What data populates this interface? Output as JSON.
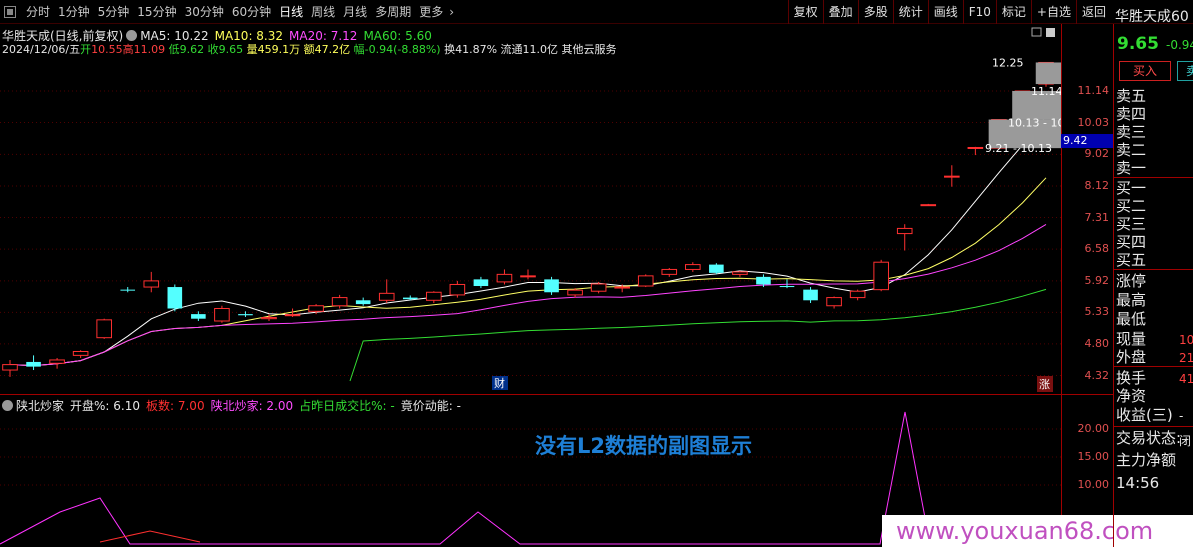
{
  "toolbar": {
    "timeframes": [
      "分时",
      "1分钟",
      "5分钟",
      "15分钟",
      "30分钟",
      "60分钟",
      "日线",
      "周线",
      "月线",
      "多周期",
      "更多"
    ],
    "active_timeframe": "日线",
    "tools": [
      "复权",
      "叠加",
      "多股",
      "统计",
      "画线",
      "F10",
      "标记",
      "+自选",
      "返回"
    ]
  },
  "stock": {
    "name": "华胜天成",
    "code_partial": "60",
    "price": "9.65",
    "change": "-0.94"
  },
  "main_chart": {
    "title": "华胜天成(日线,前复权)",
    "ma_labels": [
      {
        "text": "MA5: 10.22",
        "color": "#e6e6e6"
      },
      {
        "text": "MA10: 8.32",
        "color": "#ffff5c"
      },
      {
        "text": "MA20: 7.12",
        "color": "#ff4dff"
      },
      {
        "text": "MA60: 5.60",
        "color": "#33dd33"
      }
    ],
    "day_info": {
      "date": "2024/12/06/五",
      "open_label": "开",
      "open": "10.55",
      "high_label": "高",
      "high": "11.09",
      "low_label": "低",
      "low": "9.62",
      "close_label": "收",
      "close": "9.65",
      "vol_label": "量",
      "vol": "459.1万",
      "amt_label": "额",
      "amt": "47.2亿",
      "pct_label": "幅",
      "pct": "-0.94(-8.88%)",
      "turnover_label": "换",
      "turnover": "41.87%",
      "float_label": "流通",
      "float": "11.0亿",
      "sector": "其他云服务"
    },
    "y_axis_ticks": [
      "11.14",
      "10.03",
      "9.02",
      "8.12",
      "7.31",
      "6.58",
      "5.92",
      "5.33",
      "4.80",
      "4.32"
    ],
    "current_price_flag": "9.42",
    "annotations": [
      "12.25",
      "11.14",
      "10.13 - 10",
      "9.21 - 10.13"
    ],
    "markers": {
      "fin": "财",
      "zhang": "涨"
    }
  },
  "chart_data": {
    "type": "candlestick",
    "title": "华胜天成(日线,前复权)",
    "ylim": [
      4.2,
      12.6
    ],
    "y_scale": "log",
    "candles": [
      {
        "o": 4.4,
        "h": 4.55,
        "l": 4.3,
        "c": 4.48
      },
      {
        "o": 4.52,
        "h": 4.62,
        "l": 4.4,
        "c": 4.45
      },
      {
        "o": 4.5,
        "h": 4.58,
        "l": 4.42,
        "c": 4.55
      },
      {
        "o": 4.62,
        "h": 4.7,
        "l": 4.58,
        "c": 4.68
      },
      {
        "o": 4.9,
        "h": 5.22,
        "l": 4.88,
        "c": 5.2
      },
      {
        "o": 5.75,
        "h": 5.8,
        "l": 5.7,
        "c": 5.74
      },
      {
        "o": 5.8,
        "h": 6.1,
        "l": 5.7,
        "c": 5.92
      },
      {
        "o": 5.8,
        "h": 5.85,
        "l": 5.35,
        "c": 5.4
      },
      {
        "o": 5.3,
        "h": 5.35,
        "l": 5.18,
        "c": 5.22
      },
      {
        "o": 5.18,
        "h": 5.45,
        "l": 5.15,
        "c": 5.4
      },
      {
        "o": 5.3,
        "h": 5.35,
        "l": 5.25,
        "c": 5.28
      },
      {
        "o": 5.22,
        "h": 5.3,
        "l": 5.18,
        "c": 5.24
      },
      {
        "o": 5.28,
        "h": 5.4,
        "l": 5.25,
        "c": 5.29
      },
      {
        "o": 5.35,
        "h": 5.48,
        "l": 5.3,
        "c": 5.45
      },
      {
        "o": 5.45,
        "h": 5.65,
        "l": 5.4,
        "c": 5.6
      },
      {
        "o": 5.55,
        "h": 5.6,
        "l": 5.45,
        "c": 5.48
      },
      {
        "o": 5.55,
        "h": 5.95,
        "l": 5.5,
        "c": 5.68
      },
      {
        "o": 5.6,
        "h": 5.64,
        "l": 5.55,
        "c": 5.57
      },
      {
        "o": 5.55,
        "h": 5.72,
        "l": 5.5,
        "c": 5.7
      },
      {
        "o": 5.65,
        "h": 5.92,
        "l": 5.6,
        "c": 5.85
      },
      {
        "o": 5.95,
        "h": 6.0,
        "l": 5.78,
        "c": 5.82
      },
      {
        "o": 5.9,
        "h": 6.15,
        "l": 5.85,
        "c": 6.05
      },
      {
        "o": 6.0,
        "h": 6.15,
        "l": 5.95,
        "c": 6.02
      },
      {
        "o": 5.95,
        "h": 6.0,
        "l": 5.65,
        "c": 5.7
      },
      {
        "o": 5.65,
        "h": 5.78,
        "l": 5.6,
        "c": 5.74
      },
      {
        "o": 5.72,
        "h": 5.9,
        "l": 5.68,
        "c": 5.86
      },
      {
        "o": 5.8,
        "h": 5.85,
        "l": 5.7,
        "c": 5.8
      },
      {
        "o": 5.82,
        "h": 6.05,
        "l": 5.8,
        "c": 6.02
      },
      {
        "o": 6.05,
        "h": 6.18,
        "l": 6.0,
        "c": 6.15
      },
      {
        "o": 6.15,
        "h": 6.3,
        "l": 6.1,
        "c": 6.25
      },
      {
        "o": 6.25,
        "h": 6.28,
        "l": 6.05,
        "c": 6.08
      },
      {
        "o": 6.05,
        "h": 6.12,
        "l": 6.0,
        "c": 6.1
      },
      {
        "o": 6.0,
        "h": 6.05,
        "l": 5.8,
        "c": 5.85
      },
      {
        "o": 5.82,
        "h": 5.95,
        "l": 5.78,
        "c": 5.8
      },
      {
        "o": 5.75,
        "h": 5.8,
        "l": 5.5,
        "c": 5.55
      },
      {
        "o": 5.45,
        "h": 5.62,
        "l": 5.4,
        "c": 5.6
      },
      {
        "o": 5.6,
        "h": 5.75,
        "l": 5.55,
        "c": 5.72
      },
      {
        "o": 5.75,
        "h": 6.35,
        "l": 5.72,
        "c": 6.3
      },
      {
        "o": 6.93,
        "h": 7.15,
        "l": 6.55,
        "c": 7.05
      },
      {
        "o": 7.63,
        "h": 7.65,
        "l": 7.6,
        "c": 7.63
      },
      {
        "o": 8.39,
        "h": 8.7,
        "l": 8.1,
        "c": 8.39
      },
      {
        "o": 9.23,
        "h": 9.25,
        "l": 9.0,
        "c": 9.23
      },
      {
        "o": 9.21,
        "h": 10.13,
        "l": 9.21,
        "c": 10.13
      },
      {
        "o": 10.55,
        "h": 11.14,
        "l": 10.4,
        "c": 11.14
      },
      {
        "o": 11.4,
        "h": 12.25,
        "l": 11.3,
        "c": 12.25
      }
    ],
    "up_color": "#ff3030",
    "down_color": "#54ffff"
  },
  "sub_chart": {
    "labels": [
      {
        "text": "陕北炒家",
        "color": "#e6e6e6"
      },
      {
        "text": "开盘%: 6.10",
        "color": "#e6e6e6"
      },
      {
        "text": "板数: 7.00",
        "color": "#ff3030"
      },
      {
        "text": "陕北炒家: 2.00",
        "color": "#ff4dff"
      },
      {
        "text": "占昨日成交比%: -",
        "color": "#33dd33"
      },
      {
        "text": "竟价动能: -",
        "color": "#e6e6e6"
      }
    ],
    "note": "没有L2数据的副图显示",
    "y_axis_ticks": [
      "20.00",
      "15.00",
      "10.00"
    ]
  },
  "watermark": "www.youxuan68.com",
  "right_panel": {
    "buy_label": "买入",
    "sell_label": "卖",
    "rows": [
      {
        "label": "卖五",
        "value": ""
      },
      {
        "label": "卖四",
        "value": ""
      },
      {
        "label": "卖三",
        "value": ""
      },
      {
        "label": "卖二",
        "value": ""
      },
      {
        "label": "卖一",
        "value": ""
      },
      {
        "label": "买一",
        "value": ""
      },
      {
        "label": "买二",
        "value": ""
      },
      {
        "label": "买三",
        "value": ""
      },
      {
        "label": "买四",
        "value": ""
      },
      {
        "label": "买五",
        "value": ""
      },
      {
        "label": "涨停",
        "value": ""
      },
      {
        "label": "最高",
        "value": ""
      },
      {
        "label": "最低",
        "value": ""
      },
      {
        "label": "现量",
        "value": "10"
      },
      {
        "label": "外盘",
        "value": "21"
      },
      {
        "label": "换手",
        "value": "41"
      },
      {
        "label": "净资",
        "value": ""
      },
      {
        "label": "收益(三)",
        "value": "-"
      },
      {
        "label": "交易状态:",
        "value": "闭"
      },
      {
        "label": "主力净额",
        "value": ""
      },
      {
        "label": "14:56",
        "value": ""
      }
    ]
  }
}
